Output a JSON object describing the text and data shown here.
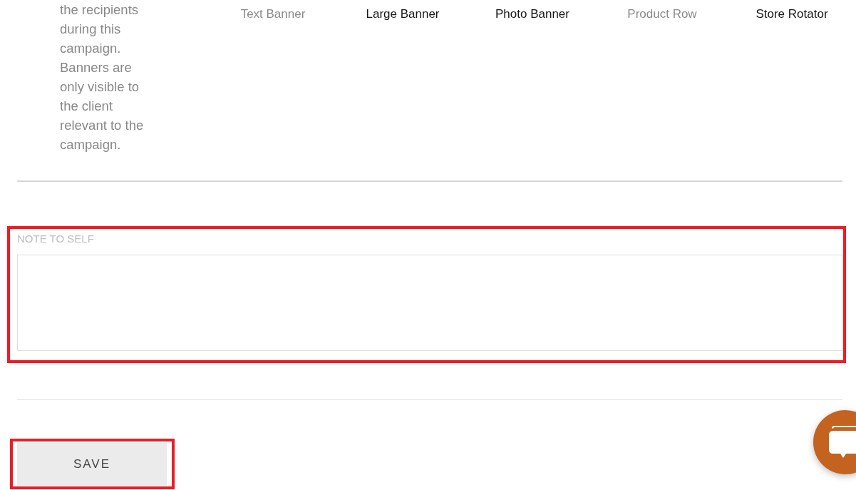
{
  "description": "the recipients during this campaign. Banners are only visible to the client relevant to the campaign.",
  "banner_types": [
    {
      "label": "Text Banner",
      "disabled": true
    },
    {
      "label": "Large Banner",
      "disabled": false
    },
    {
      "label": "Photo Banner",
      "disabled": false
    },
    {
      "label": "Product Row",
      "disabled": true
    },
    {
      "label": "Store Rotator",
      "disabled": false
    }
  ],
  "note": {
    "label": "NOTE TO SELF",
    "highlighted": true
  },
  "save_button": {
    "label": "SAVE",
    "highlighted": true
  }
}
